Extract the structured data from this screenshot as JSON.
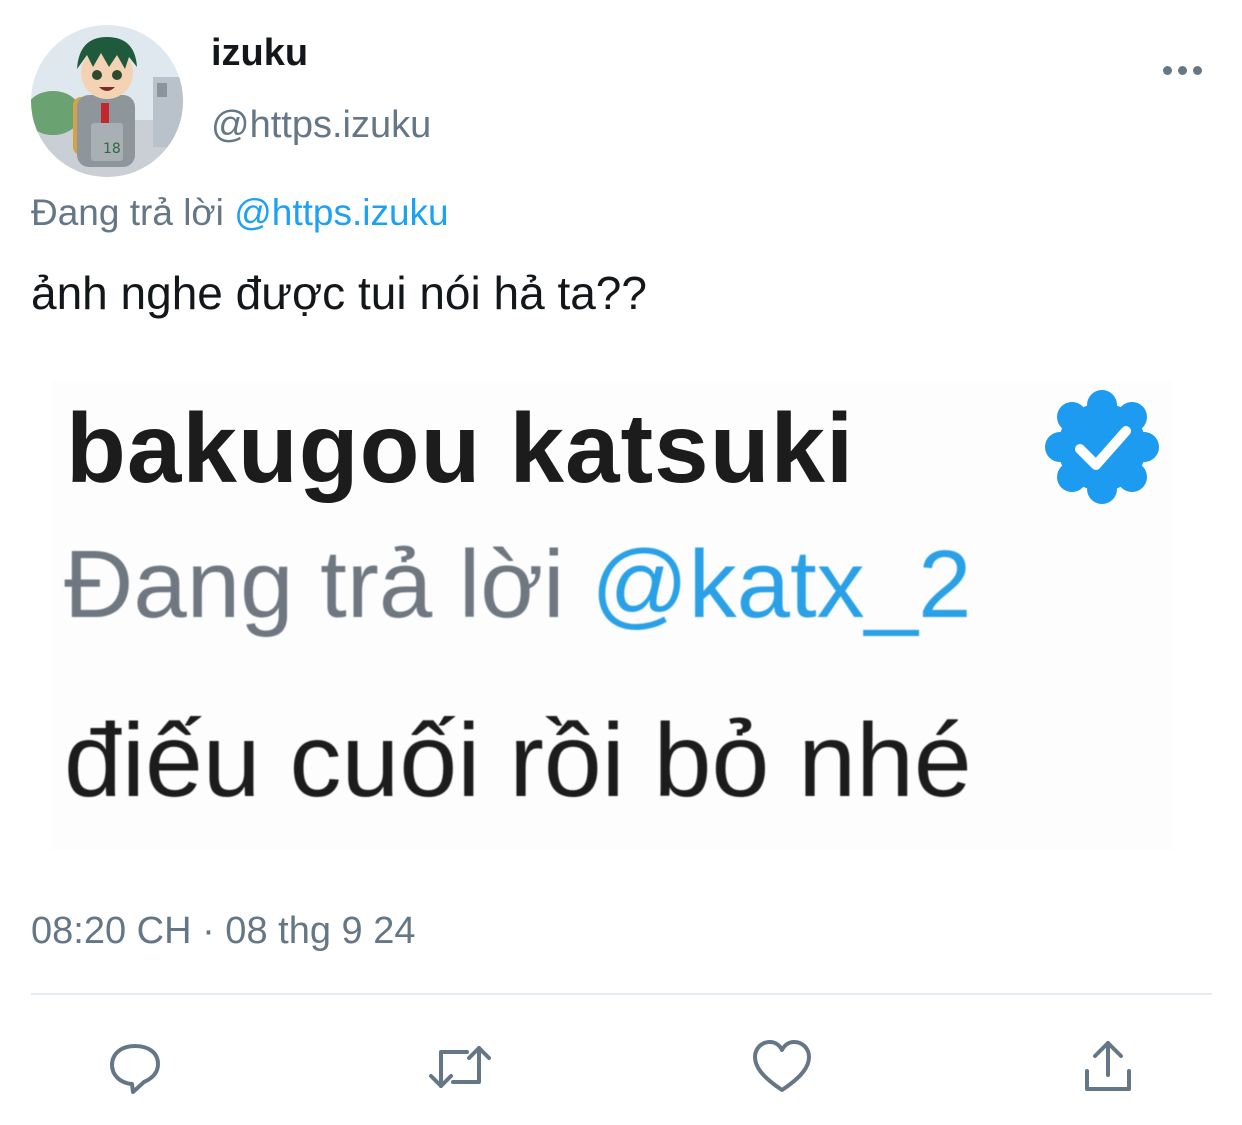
{
  "tweet": {
    "display_name": "izuku",
    "handle": "@https.izuku",
    "replying_prefix": "Đang trả lời",
    "replying_to": "@https.izuku",
    "text": "ảnh nghe được tui nói hả ta??",
    "timestamp": "08:20 CH · 08 thg 9 24"
  },
  "quoted_image": {
    "name": "bakugou katsuki",
    "reply_prefix": "Đang trả lời",
    "reply_handle": "@katx_2",
    "text": "điếu cuối rồi bỏ nhé",
    "badge_icon": "verified-badge-icon"
  },
  "actions": [
    {
      "icon": "reply-icon"
    },
    {
      "icon": "retweet-icon"
    },
    {
      "icon": "like-icon"
    },
    {
      "icon": "share-icon"
    }
  ],
  "colors": {
    "text": "#14171a",
    "secondary": "#657786",
    "link": "#1da1f2",
    "divider": "#e6ecf0"
  }
}
